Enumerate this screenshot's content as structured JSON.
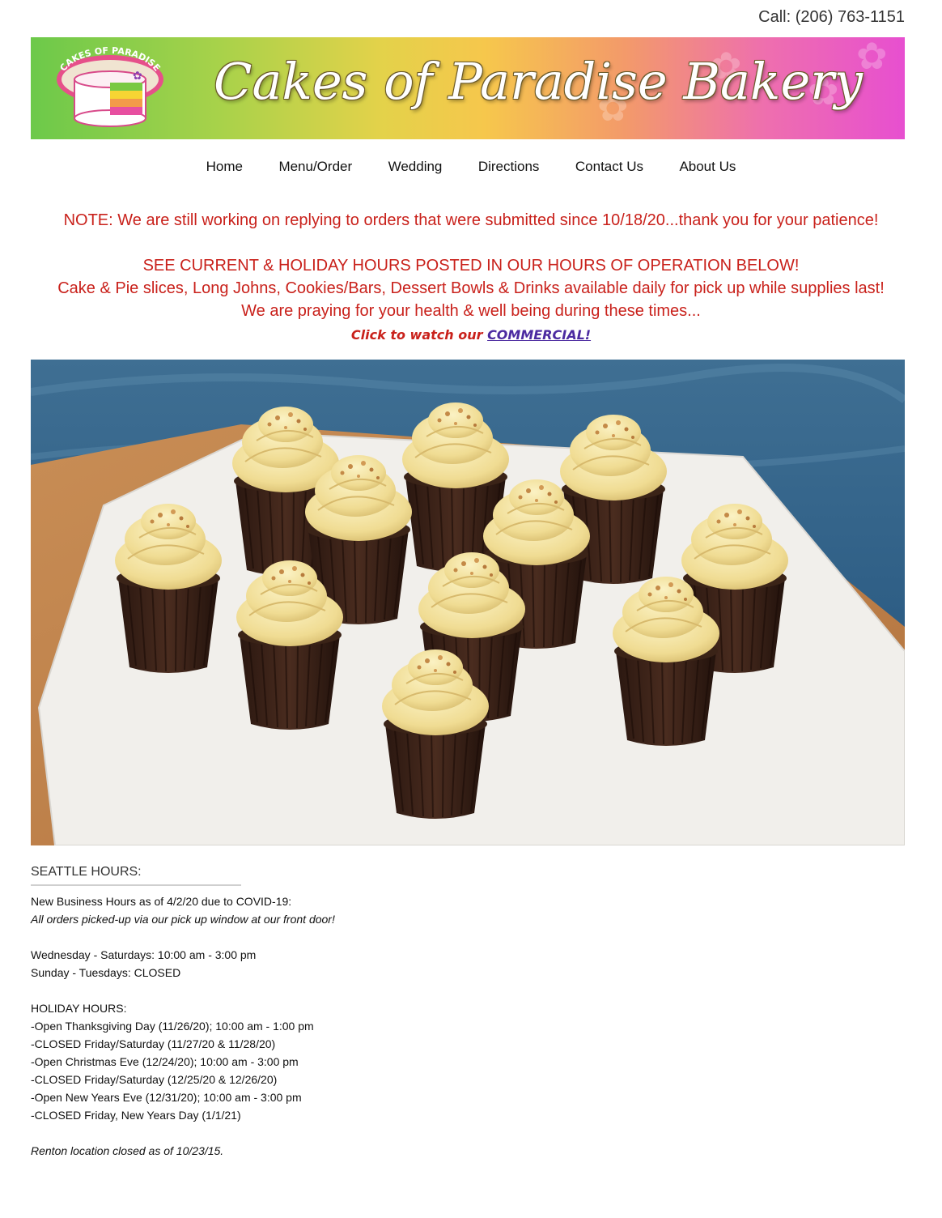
{
  "header": {
    "phone": "Call: (206) 763-1151",
    "brand_title": "Cakes of Paradise Bakery",
    "logo_text": "CAKES OF PARADISE"
  },
  "nav": {
    "items": [
      "Home",
      "Menu/Order",
      "Wedding",
      "Directions",
      "Contact Us",
      "About Us"
    ]
  },
  "notices": {
    "note": "NOTE: We are still working on replying to orders that were submitted since 10/18/20...thank you for your patience!",
    "line1": "SEE CURRENT & HOLIDAY HOURS POSTED IN OUR HOURS OF OPERATION BELOW!",
    "line2": "Cake & Pie slices, Long Johns, Cookies/Bars, Dessert Bowls & Drinks available daily for pick up while supplies last!",
    "line3": "We are praying for your health & well being during these times...",
    "cta_prefix": "Click to watch our ",
    "cta_link": "COMMERCIAL!"
  },
  "hours": {
    "heading": "SEATTLE HOURS:",
    "intro": "New Business Hours as of 4/2/20 due to COVID-19:",
    "pickup_note": "All orders picked-up via our pick up window at our front door!",
    "regular": [
      "Wednesday - Saturdays: 10:00 am - 3:00 pm",
      "Sunday - Tuesdays: CLOSED"
    ],
    "holiday_heading": "HOLIDAY HOURS:",
    "holiday": [
      "-Open Thanksgiving Day (11/26/20); 10:00 am - 1:00 pm",
      "-CLOSED Friday/Saturday (11/27/20 & 11/28/20)",
      "-Open Christmas Eve (12/24/20); 10:00 am - 3:00 pm",
      "-CLOSED Friday/Saturday (12/25/20 & 12/26/20)",
      "-Open New Years Eve (12/31/20); 10:00 am - 3:00 pm",
      "-CLOSED Friday, New Years Day (1/1/21)"
    ],
    "renton_note": "Renton location closed as of 10/23/15."
  }
}
